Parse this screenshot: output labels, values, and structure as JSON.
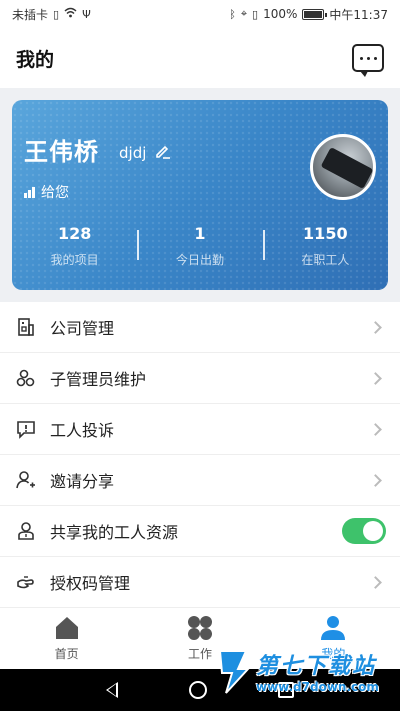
{
  "status_bar": {
    "carrier": "未插卡",
    "battery_pct": "100%",
    "battery_level": 1.0,
    "time": "中午11:37"
  },
  "header": {
    "title": "我的"
  },
  "profile": {
    "name": "王伟桥",
    "nickname": "djdj",
    "role": "给您",
    "stats": [
      {
        "value": "128",
        "label": "我的项目"
      },
      {
        "value": "1",
        "label": "今日出勤"
      },
      {
        "value": "1150",
        "label": "在职工人"
      }
    ]
  },
  "menu": [
    {
      "label": "公司管理",
      "icon": "company-icon",
      "control": "chevron"
    },
    {
      "label": "子管理员维护",
      "icon": "sub-admin-icon",
      "control": "chevron"
    },
    {
      "label": "工人投诉",
      "icon": "complaint-icon",
      "control": "chevron"
    },
    {
      "label": "邀请分享",
      "icon": "invite-icon",
      "control": "chevron"
    },
    {
      "label": "共享我的工人资源",
      "icon": "share-worker-icon",
      "control": "toggle",
      "toggle_on": true
    },
    {
      "label": "授权码管理",
      "icon": "auth-code-icon",
      "control": "chevron"
    }
  ],
  "tabs": [
    {
      "label": "首页",
      "icon": "home-icon",
      "active": false
    },
    {
      "label": "工作",
      "icon": "work-icon",
      "active": false
    },
    {
      "label": "我的",
      "icon": "profile-icon",
      "active": true
    }
  ],
  "watermark": {
    "title": "第七下载站",
    "url": "www.d7down.com"
  },
  "colors": {
    "accent": "#1f8fe5",
    "card_start": "#5aa6dc",
    "card_end": "#2f6fb5",
    "toggle_on": "#3ec26b"
  }
}
